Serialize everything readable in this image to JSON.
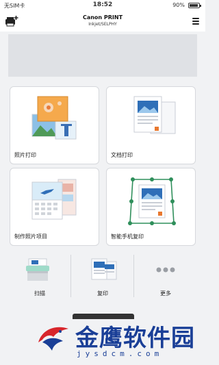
{
  "status_bar": {
    "carrier": "无SIM卡",
    "time": "18:52",
    "battery": "90%"
  },
  "header": {
    "title": "Canon PRINT",
    "subtitle": "Inkjet/SELPHY",
    "left_icon": "printer-add-icon",
    "right_icon": "menu-icon"
  },
  "cards": [
    {
      "label": "照片打印",
      "icon": "photo-print-icon"
    },
    {
      "label": "文档打印",
      "icon": "document-print-icon"
    },
    {
      "label": "制作照片项目",
      "icon": "photo-project-icon"
    },
    {
      "label": "智能手机复印",
      "icon": "smartphone-copy-icon"
    }
  ],
  "tools": [
    {
      "label": "扫描",
      "icon": "scan-icon"
    },
    {
      "label": "复印",
      "icon": "copy-icon"
    },
    {
      "label": "更多",
      "icon": "more-icon"
    }
  ],
  "watermark": {
    "text": "金鹰软件园",
    "url": "jysdcm.com"
  },
  "colors": {
    "background": "#f1f2f4",
    "card": "#ffffff",
    "accent_green": "#2f8f5b",
    "watermark_blue": "#1a3f97",
    "watermark_red": "#d8262c"
  }
}
